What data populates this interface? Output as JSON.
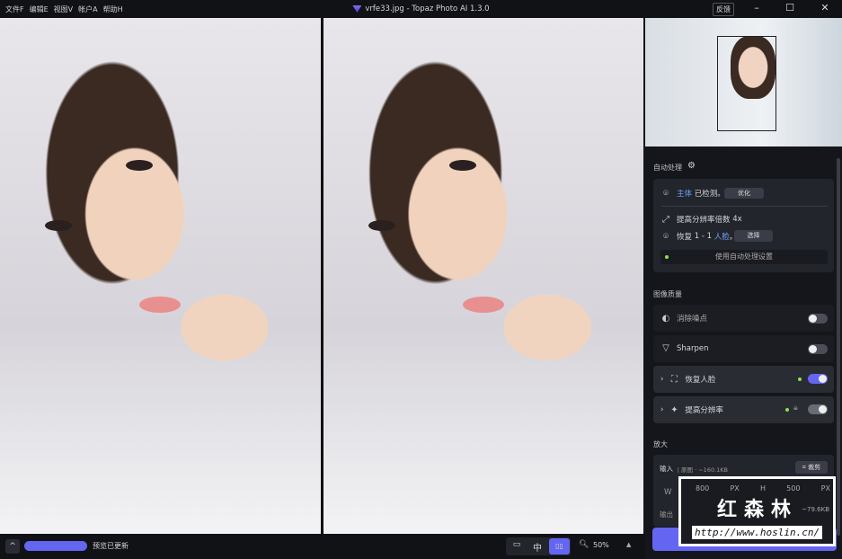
{
  "menu": [
    "文件F",
    "编辑E",
    "视图V",
    "帐户A",
    "帮助H"
  ],
  "window": {
    "title": "vrfe33.jpg - Topaz Photo AI 1.3.0",
    "feedback": "反馈",
    "minimize": "–",
    "maximize": "☐",
    "close": "✕"
  },
  "auto": {
    "heading": "自动处理",
    "subject_label": "主体",
    "subject_text": "已检测。",
    "optimize": "优化",
    "upscale_text": "提高分辨率倍数",
    "upscale_value": "4x",
    "face_text": "恢复",
    "face_count": "1 - 1",
    "face_label": "人脸",
    "face_dot": "。",
    "select": "选择",
    "apply": "使用自动处理设置"
  },
  "quality": {
    "heading": "图像质量",
    "items": [
      {
        "label": "消除噪点",
        "on": false
      },
      {
        "label": "Sharpen",
        "on": false
      },
      {
        "label": "恢复人脸",
        "on": true
      },
      {
        "label": "提高分辨率",
        "on": true
      }
    ]
  },
  "enlarge": {
    "heading": "放大",
    "input_label": "输入",
    "input_info": "| 原图 · ~160.1KB",
    "crop": "裁剪",
    "w_label": "W",
    "w_value": "800",
    "w_unit": "PX",
    "h_label": "H",
    "h_value": "500",
    "h_unit": "PX",
    "output_label": "输出",
    "output_size": "~79.6KB"
  },
  "bottom": {
    "status": "预览已更新",
    "zoom": "50%",
    "progress": 100
  },
  "watermark": {
    "brand": "红森林",
    "url": "http://www.hoslin.cn/"
  },
  "colors": {
    "accent": "#6466f1",
    "dot": "#8be04e"
  }
}
